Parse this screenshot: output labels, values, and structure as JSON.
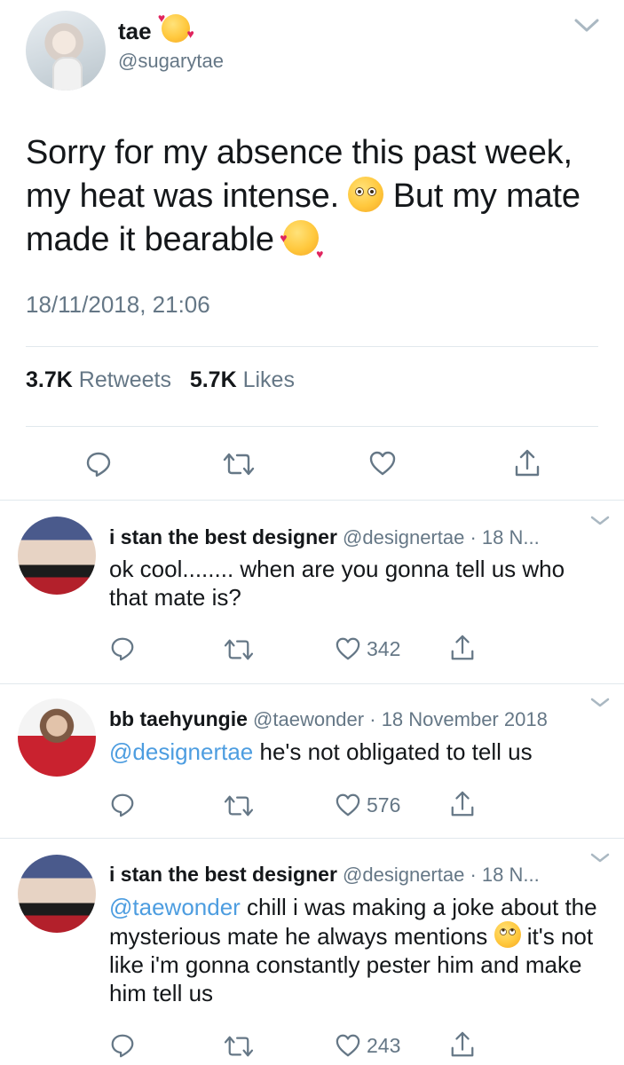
{
  "tweet": {
    "name": "tae",
    "handle": "@sugarytae",
    "text_1": "Sorry for my absence this past week, my heat was intense.",
    "text_2": "But my mate made it bearable",
    "timestamp": "18/11/2018, 21:06",
    "retweets_count": "3.7K",
    "retweets_label": "Retweets",
    "likes_count": "5.7K",
    "likes_label": "Likes"
  },
  "replies": [
    {
      "name": "i stan the best designer",
      "handle": "@designertae",
      "sep": "·",
      "date": "18 N...",
      "text": "ok cool........ when are you gonna tell us who that mate is?",
      "likes": "342"
    },
    {
      "name": "bb taehyungie",
      "handle": "@taewonder",
      "sep": "·",
      "date": "18 November 2018",
      "mention": "@designertae",
      "text": "he's not obligated to tell us",
      "likes": "576"
    },
    {
      "name": "i stan the best designer",
      "handle": "@designertae",
      "sep": "·",
      "date": "18 N...",
      "mention": "@taewonder",
      "text_1": "chill i was making a joke about the mysterious mate he always mentions",
      "text_2": "it's not like i'm gonna constantly pester him and make him tell us",
      "likes": "243"
    }
  ],
  "icons": [
    "reply-icon",
    "retweet-icon",
    "like-icon",
    "share-icon",
    "chevron-down-icon"
  ]
}
